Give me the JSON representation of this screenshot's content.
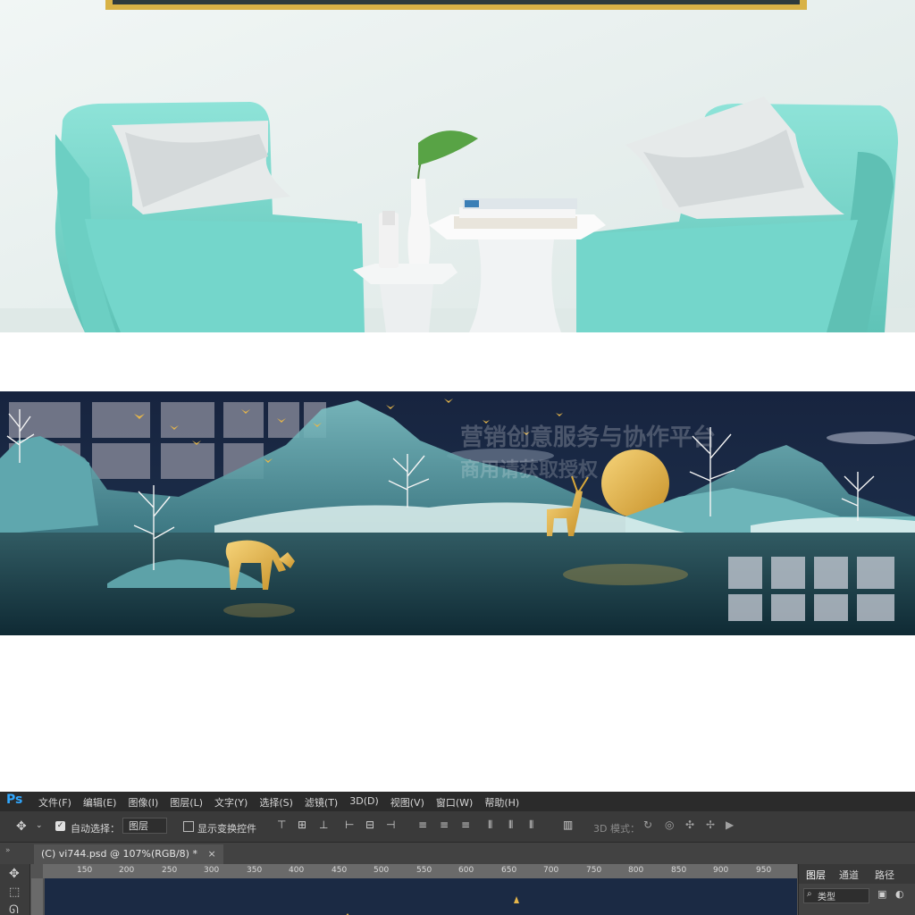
{
  "photoshop": {
    "app_logo": "Ps",
    "menu": [
      "文件(F)",
      "编辑(E)",
      "图像(I)",
      "图层(L)",
      "文字(Y)",
      "选择(S)",
      "滤镜(T)",
      "3D(D)",
      "视图(V)",
      "窗口(W)",
      "帮助(H)"
    ],
    "options": {
      "auto_select_label": "自动选择：",
      "auto_select_checked": true,
      "layer_select_value": "图层",
      "show_transform_label": "显示变换控件",
      "show_transform_checked": false,
      "mode_3d_label": "3D 模式："
    },
    "document_tab": "(C) vi744.psd @ 107%(RGB/8) *",
    "ruler_ticks": [
      "150",
      "200",
      "250",
      "300",
      "350",
      "400",
      "450",
      "500",
      "550",
      "600",
      "650",
      "700",
      "750",
      "800",
      "850",
      "900",
      "950"
    ],
    "panel_tabs": [
      "图层",
      "通道",
      "路径"
    ],
    "panel_filter": "类型",
    "icons": [
      "move-icon",
      "marquee-icon",
      "lasso-icon",
      "close-icon",
      "chevron-down-icon",
      "collapse-icon"
    ]
  },
  "painting": {
    "watermark_line1": "营销创意服务与协作平台",
    "watermark_line2": "商用请获取授权"
  },
  "colors": {
    "ps_blue": "#31a8ff",
    "night_sky": "#1b2a44",
    "moon_gold": "#f1c23e",
    "armchair_mint": "#7fd9cf"
  }
}
